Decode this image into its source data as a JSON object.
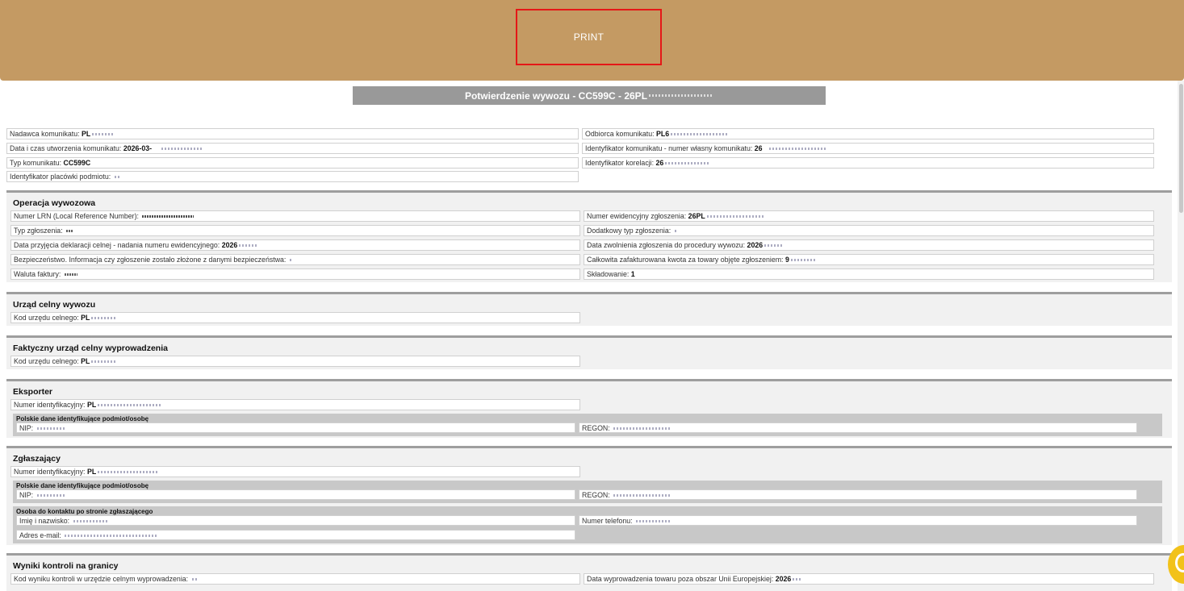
{
  "toolbar": {
    "print_label": "PRINT"
  },
  "document": {
    "title": "Potwierdzenie wywozu - CC599C - 26PL"
  },
  "header_fields": {
    "sender": {
      "label": "Nadawca komunikatu:",
      "value": "PL"
    },
    "recipient": {
      "label": "Odbiorca komunikatu:",
      "value": "PL6"
    },
    "created": {
      "label": "Data i czas utworzenia komunikatu:",
      "value": "2026-03-"
    },
    "msg_id": {
      "label": "Identyfikator komunikatu - numer własny komunikatu:",
      "value": "26"
    },
    "msg_type": {
      "label": "Typ komunikatu:",
      "value": "CC599C"
    },
    "correlation": {
      "label": "Identyfikator korelacji:",
      "value": "26"
    },
    "branch": {
      "label": "Identyfikator placówki podmiotu:",
      "value": ""
    }
  },
  "sections": {
    "export_operation": {
      "title": "Operacja wywozowa",
      "lrn": {
        "label": "Numer LRN (Local Reference Number):",
        "value": ""
      },
      "mrn": {
        "label": "Numer ewidencyjny zgłoszenia:",
        "value": "26PL"
      },
      "decl_type": {
        "label": "Typ zgłoszenia:",
        "value": ""
      },
      "add_decl_type": {
        "label": "Dodatkowy typ zgłoszenia:",
        "value": ""
      },
      "acceptance_date": {
        "label": "Data przyjęcia deklaracji celnej - nadania numeru ewidencyjnego:",
        "value": "2026"
      },
      "release_date": {
        "label": "Data zwolnienia zgłoszenia do procedury wywozu:",
        "value": "2026"
      },
      "security": {
        "label": "Bezpieczeństwo. Informacja czy zgłoszenie zostało złożone z danymi bezpieczeństwa:",
        "value": ""
      },
      "total_amount": {
        "label": "Całkowita zafakturowana kwota za towary objęte zgłoszeniem:",
        "value": "9"
      },
      "currency": {
        "label": "Waluta faktury:",
        "value": ""
      },
      "storage": {
        "label": "Składowanie:",
        "value": "1"
      }
    },
    "customs_office_export": {
      "title": "Urząd celny wywozu",
      "code": {
        "label": "Kod urzędu celnego:",
        "value": "PL"
      }
    },
    "customs_office_exit": {
      "title": "Faktyczny urząd celny wyprowadzenia",
      "code": {
        "label": "Kod urzędu celnego:",
        "value": "PL"
      }
    },
    "exporter": {
      "title": "Eksporter",
      "id": {
        "label": "Numer identyfikacyjny:",
        "value": "PL"
      },
      "polish_data_title": "Polskie dane identyfikujące podmiot/osobę",
      "nip": {
        "label": "NIP:",
        "value": ""
      },
      "regon": {
        "label": "REGON:",
        "value": ""
      }
    },
    "declarant": {
      "title": "Zgłaszający",
      "id": {
        "label": "Numer identyfikacyjny:",
        "value": "PL"
      },
      "polish_data_title": "Polskie dane identyfikujące podmiot/osobę",
      "nip": {
        "label": "NIP:",
        "value": ""
      },
      "regon": {
        "label": "REGON:",
        "value": ""
      },
      "contact_title": "Osoba do kontaktu po stronie zgłaszającego",
      "name": {
        "label": "Imię i nazwisko:",
        "value": ""
      },
      "phone": {
        "label": "Numer telefonu:",
        "value": ""
      },
      "email": {
        "label": "Adres e-mail:",
        "value": ""
      }
    },
    "border_control": {
      "title": "Wyniki kontroli na granicy",
      "result_code": {
        "label": "Kod wyniku kontroli w urzędzie celnym wyprowadzenia:",
        "value": ""
      },
      "exit_date": {
        "label": "Data wyprowadzenia towaru poza obszar Unii Europejskiej:",
        "value": "2026"
      }
    }
  },
  "colors": {
    "topbar": "#c49a63",
    "print_border": "#e51717",
    "title_bar": "#999999",
    "help_bubble": "#f2c21a"
  },
  "icons": {
    "help": "help-bubble-icon"
  }
}
